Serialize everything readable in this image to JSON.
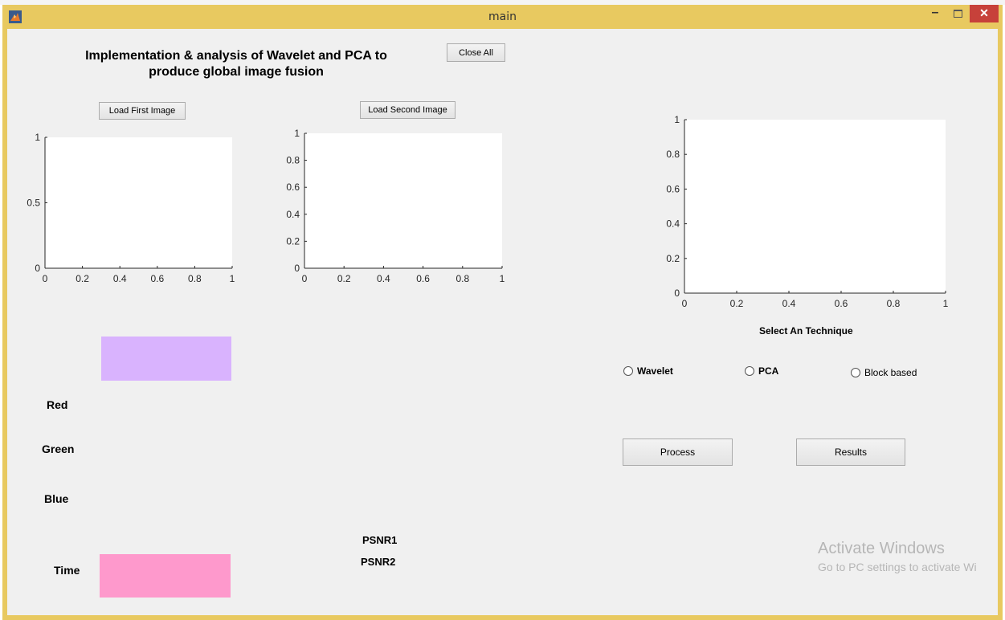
{
  "window": {
    "title": "main",
    "minimize_glyph": "–",
    "close_glyph": "✕"
  },
  "gui": {
    "title_line1": "Implementation & analysis of Wavelet and PCA to",
    "title_line2": "produce global image fusion",
    "close_all": "Close All",
    "load_first": "Load First Image",
    "load_second": "Load Second Image",
    "select_technique": "Select An Technique",
    "radios": [
      "Wavelet",
      "PCA",
      "Block based"
    ],
    "process": "Process",
    "results": "Results",
    "labels": {
      "red": "Red",
      "green": "Green",
      "blue": "Blue",
      "time": "Time",
      "psnr1": "PSNR1",
      "psnr2": "PSNR2"
    }
  },
  "colors": {
    "top_swatch": "#d9b3fe",
    "time_swatch": "#fe99cc",
    "window_frame": "#e8c960",
    "client_bg": "#f0f0f0"
  },
  "chart_data": [
    {
      "type": "scatter",
      "title": "",
      "xlabel": "",
      "ylabel": "",
      "xlim": [
        0,
        1
      ],
      "ylim": [
        0,
        1
      ],
      "xticks": [
        "0",
        "0.2",
        "0.4",
        "0.6",
        "0.8",
        "1"
      ],
      "yticks": [
        "0",
        "0.5",
        "1"
      ],
      "series": []
    },
    {
      "type": "scatter",
      "title": "",
      "xlabel": "",
      "ylabel": "",
      "xlim": [
        0,
        1
      ],
      "ylim": [
        0,
        1
      ],
      "xticks": [
        "0",
        "0.2",
        "0.4",
        "0.6",
        "0.8",
        "1"
      ],
      "yticks": [
        "0",
        "0.2",
        "0.4",
        "0.6",
        "0.8",
        "1"
      ],
      "series": []
    },
    {
      "type": "scatter",
      "title": "",
      "xlabel": "",
      "ylabel": "",
      "xlim": [
        0,
        1
      ],
      "ylim": [
        0,
        1
      ],
      "xticks": [
        "0",
        "0.2",
        "0.4",
        "0.6",
        "0.8",
        "1"
      ],
      "yticks": [
        "0",
        "0.2",
        "0.4",
        "0.6",
        "0.8",
        "1"
      ],
      "series": []
    }
  ],
  "watermark": {
    "line1": "Activate Windows",
    "line2": "Go to PC settings to activate Wi"
  }
}
